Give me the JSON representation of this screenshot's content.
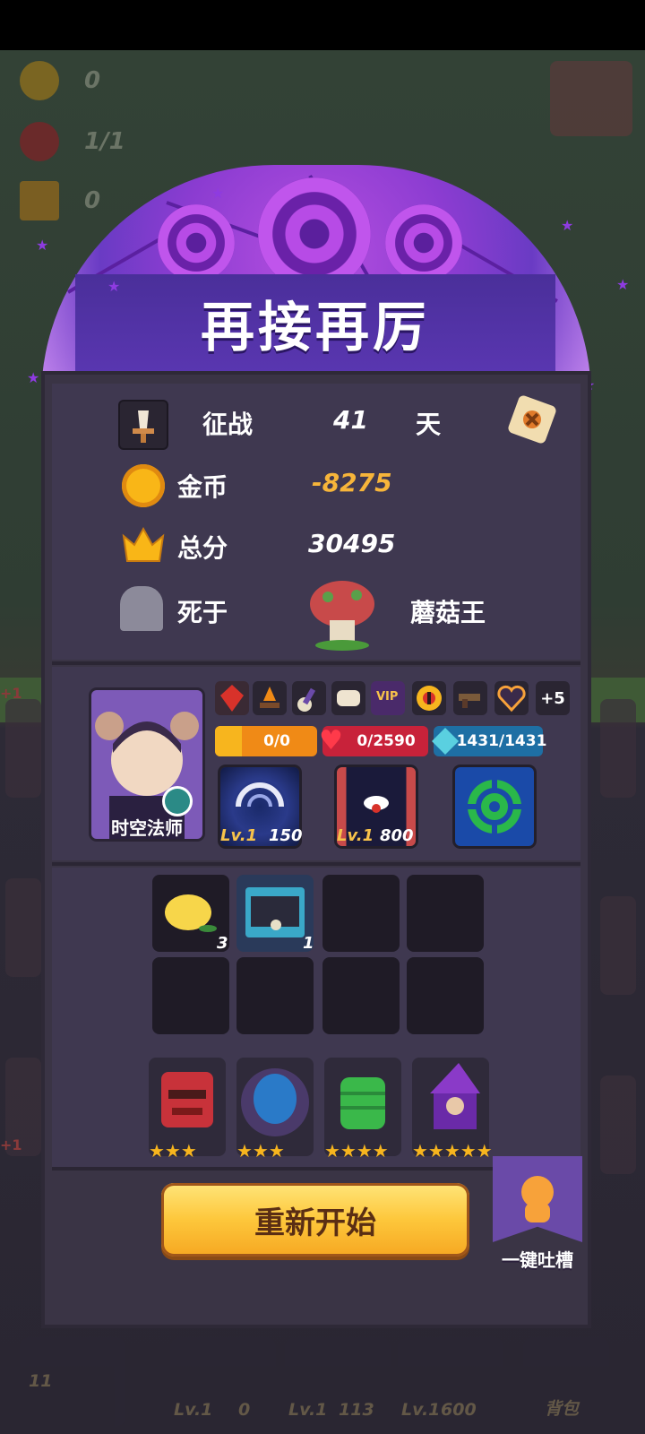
{
  "background": {
    "counters": [
      {
        "icon": "coin-icon",
        "value": "0"
      },
      {
        "icon": "demon-icon",
        "value": "1/1"
      },
      {
        "icon": "crown-icon",
        "value": "0"
      }
    ],
    "bottom_bar": [
      {
        "level": "Lv.1",
        "value": ""
      },
      {
        "level": "Lv.1",
        "value": "0"
      },
      {
        "level": "Lv.1",
        "value": "113"
      },
      {
        "level": "Lv.1",
        "value": "600"
      },
      {
        "label": "背包"
      }
    ],
    "card_number": "11",
    "plus_badge": "+1"
  },
  "title": "再接再厉",
  "stats": {
    "days_label": "征战",
    "days_value": "41",
    "days_unit": "天",
    "gold_label": "金币",
    "gold_value": "-8275",
    "score_label": "总分",
    "score_value": "30495",
    "death_label": "死于",
    "death_by": "蘑菇王"
  },
  "hero": {
    "name": "时空法师",
    "buffs": [
      "red-gem-icon",
      "campfire-icon",
      "bomb-wand-icon",
      "pillow-icon",
      "vip-card-icon",
      "eye-icon",
      "gun-icon",
      "heart-outline-icon"
    ],
    "more_buffs": "+5",
    "shield": "0/0",
    "hp": "0/2590",
    "mana": "1431/1431",
    "skills": [
      {
        "level": "Lv.1",
        "value": "150"
      },
      {
        "level": "Lv.1",
        "value": "800"
      },
      {
        "level": "",
        "value": ""
      }
    ]
  },
  "inventory": {
    "items": [
      {
        "icon": "lemon-icon",
        "count": "3"
      },
      {
        "icon": "creature-card-icon",
        "count": "1"
      }
    ]
  },
  "team": [
    {
      "icon": "red-golem-icon",
      "stars": "★★★"
    },
    {
      "icon": "blue-egg-icon",
      "stars": "★★★"
    },
    {
      "icon": "green-cactus-icon",
      "stars": "★★★★"
    },
    {
      "icon": "wizard-icon",
      "stars": "★★★★★"
    }
  ],
  "restart_label": "重新开始",
  "feedback_label": "一键吐槽",
  "colors": {
    "gold_negative": "#f7b53a",
    "hp_bar": "#c8223a",
    "shield_bar": "#f08a16",
    "mana_bar": "#1e6fa4"
  }
}
